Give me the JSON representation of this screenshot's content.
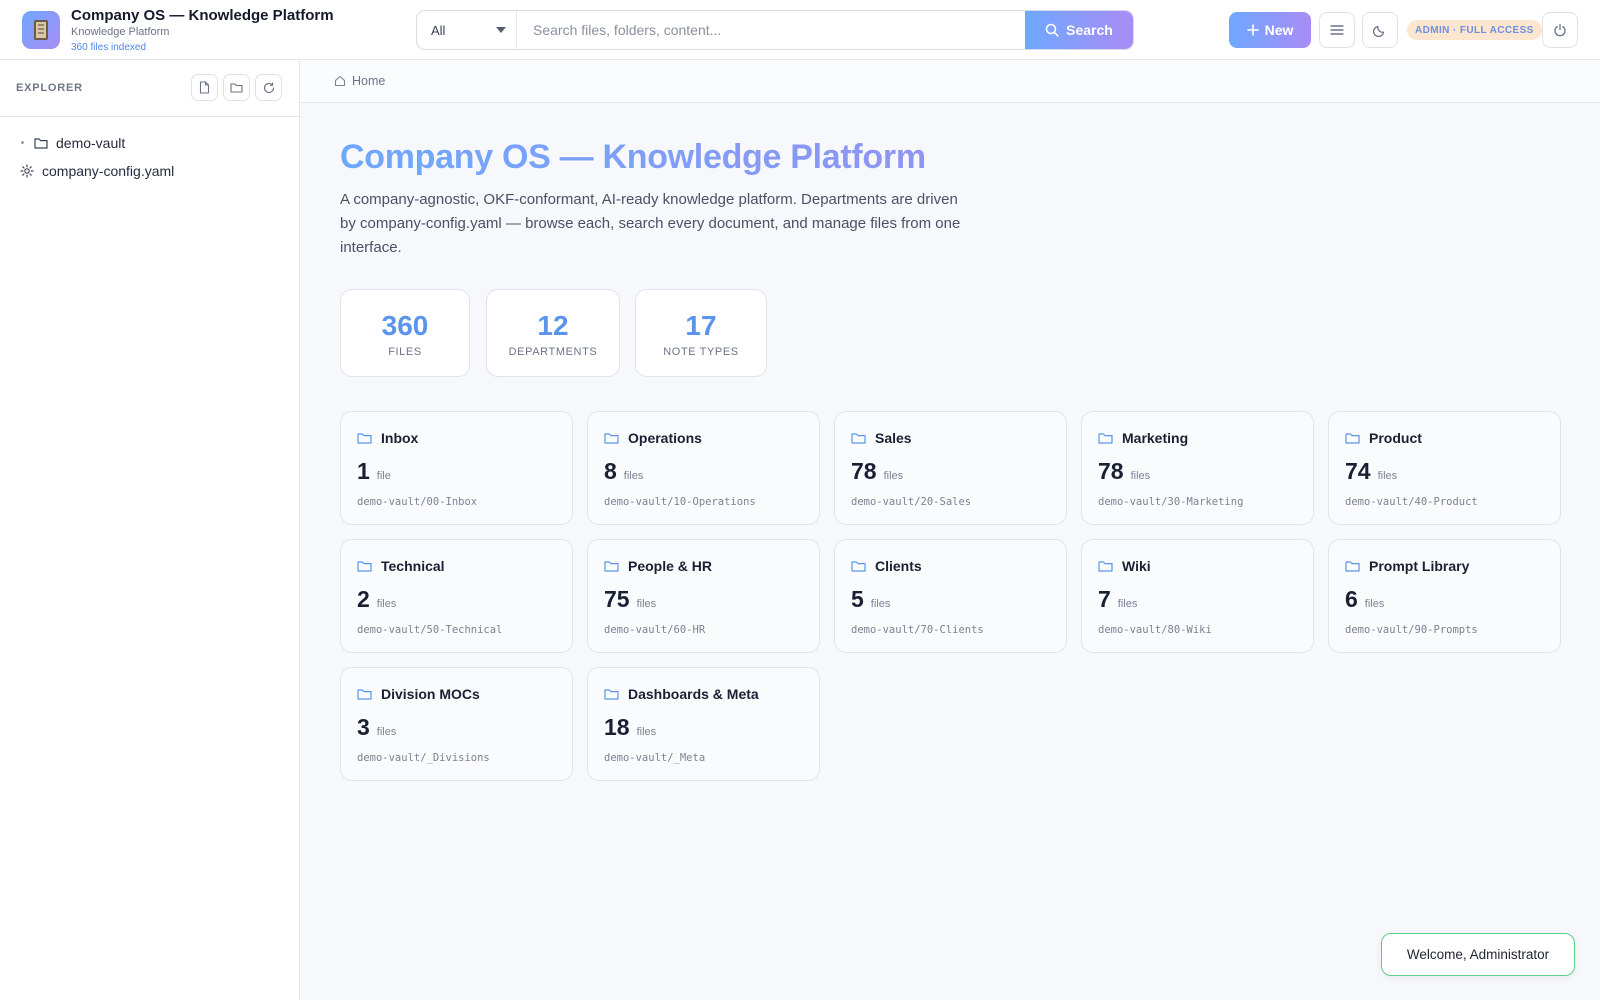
{
  "header": {
    "app_title": "Company OS — Knowledge Platform",
    "app_subtitle": "Knowledge Platform",
    "indexed_text": "360 files indexed",
    "search": {
      "scope_value": "All",
      "placeholder": "Search files, folders, content...",
      "button_label": "Search"
    },
    "new_button_label": "New",
    "admin_badge": "ADMIN · FULL ACCESS",
    "icons": [
      "menu-icon",
      "moon-icon",
      "power-icon"
    ]
  },
  "sidebar": {
    "title": "EXPLORER",
    "actions": [
      "new-file-icon",
      "new-folder-icon",
      "refresh-icon"
    ],
    "tree": [
      {
        "label": "demo-vault",
        "icon": "folder-icon"
      },
      {
        "label": "company-config.yaml",
        "icon": "gear-icon"
      }
    ]
  },
  "breadcrumb": {
    "home": "Home"
  },
  "main": {
    "title": "Company OS — Knowledge Platform",
    "description": "A company-agnostic, OKF-conformant, AI-ready knowledge platform. Departments are driven by company-config.yaml — browse each, search every document, and manage files from one interface.",
    "stats": [
      {
        "value": "360",
        "label": "FILES"
      },
      {
        "value": "12",
        "label": "DEPARTMENTS"
      },
      {
        "value": "17",
        "label": "NOTE TYPES"
      }
    ],
    "departments": [
      {
        "name": "Inbox",
        "count": "1",
        "unit": "file",
        "path": "demo-vault/00-Inbox"
      },
      {
        "name": "Operations",
        "count": "8",
        "unit": "files",
        "path": "demo-vault/10-Operations"
      },
      {
        "name": "Sales",
        "count": "78",
        "unit": "files",
        "path": "demo-vault/20-Sales"
      },
      {
        "name": "Marketing",
        "count": "78",
        "unit": "files",
        "path": "demo-vault/30-Marketing"
      },
      {
        "name": "Product",
        "count": "74",
        "unit": "files",
        "path": "demo-vault/40-Product"
      },
      {
        "name": "Technical",
        "count": "2",
        "unit": "files",
        "path": "demo-vault/50-Technical"
      },
      {
        "name": "People & HR",
        "count": "75",
        "unit": "files",
        "path": "demo-vault/60-HR"
      },
      {
        "name": "Clients",
        "count": "5",
        "unit": "files",
        "path": "demo-vault/70-Clients"
      },
      {
        "name": "Wiki",
        "count": "7",
        "unit": "files",
        "path": "demo-vault/80-Wiki"
      },
      {
        "name": "Prompt Library",
        "count": "6",
        "unit": "files",
        "path": "demo-vault/90-Prompts"
      },
      {
        "name": "Division MOCs",
        "count": "3",
        "unit": "files",
        "path": "demo-vault/_Divisions"
      },
      {
        "name": "Dashboards & Meta",
        "count": "18",
        "unit": "files",
        "path": "demo-vault/_Meta"
      }
    ]
  },
  "toast": {
    "message": "Welcome, Administrator"
  },
  "colors": {
    "accent_start": "#6ea8fe",
    "accent_end": "#a98cf5",
    "stat_value": "#5a94ec",
    "toast_border": "#5ccf8a"
  }
}
